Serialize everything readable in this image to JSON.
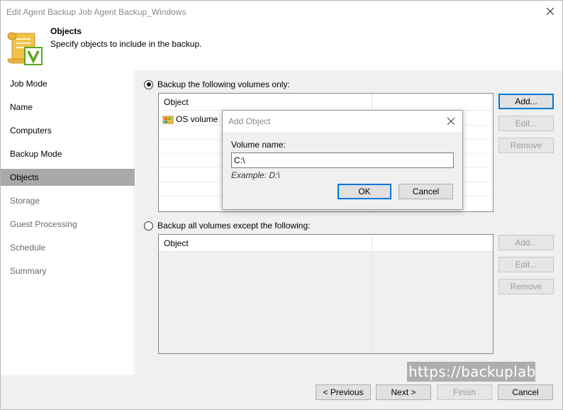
{
  "window": {
    "title": "Edit Agent Backup Job Agent Backup_Windows"
  },
  "header": {
    "title": "Objects",
    "subtitle": "Specify objects to include in the backup.",
    "icon": "scroll-checkmark-icon"
  },
  "sidebar": {
    "items": [
      {
        "label": "Job Mode",
        "state": "done"
      },
      {
        "label": "Name",
        "state": "done"
      },
      {
        "label": "Computers",
        "state": "done"
      },
      {
        "label": "Backup Mode",
        "state": "done"
      },
      {
        "label": "Objects",
        "state": "active"
      },
      {
        "label": "Storage",
        "state": "future"
      },
      {
        "label": "Guest Processing",
        "state": "future"
      },
      {
        "label": "Schedule",
        "state": "future"
      },
      {
        "label": "Summary",
        "state": "future"
      }
    ]
  },
  "include_section": {
    "radio_label": "Backup the following volumes only:",
    "selected": true,
    "column_header": "Object",
    "items": [
      {
        "label": "OS volume",
        "icon": "os-volume-icon"
      }
    ],
    "add_label": "Add...",
    "edit_label": "Edit...",
    "remove_label": "Remove"
  },
  "exclude_section": {
    "radio_label": "Backup all volumes except the following:",
    "selected": false,
    "column_header": "Object",
    "add_label": "Add...",
    "edit_label": "Edit...",
    "remove_label": "Remove"
  },
  "footer": {
    "previous_label": "< Previous",
    "next_label": "Next >",
    "finish_label": "Finish",
    "cancel_label": "Cancel"
  },
  "watermark": "https://backuplab.kr",
  "dialog": {
    "title": "Add Object",
    "label": "Volume name:",
    "value": "C:\\",
    "example": "Example: D:\\",
    "ok_label": "OK",
    "cancel_label": "Cancel"
  },
  "colors": {
    "active_nav": "#a9a9a9",
    "default_button_border": "#0078d7",
    "panel_bg": "#f0f0f0",
    "icon_gold": "#e8b53a",
    "icon_green": "#5aa61e"
  }
}
